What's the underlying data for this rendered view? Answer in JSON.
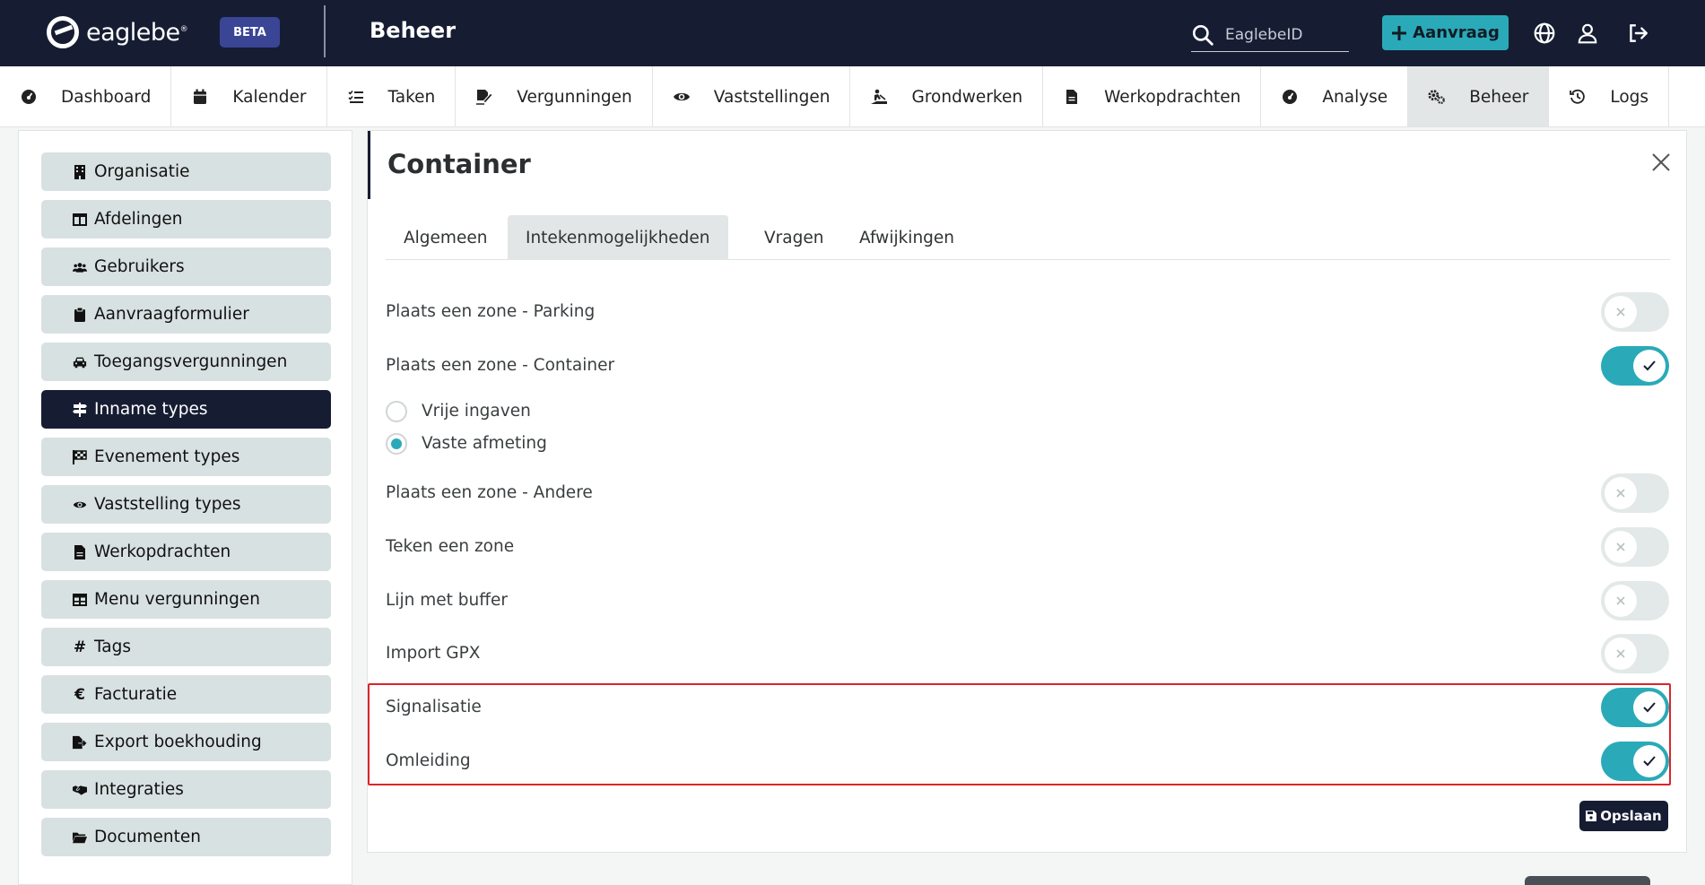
{
  "header": {
    "logo_text": "eaglebe",
    "logo_reg": "®",
    "beta_label": "BETA",
    "title": "Beheer",
    "search_placeholder": "EaglebeID",
    "aanvraag_label": "Aanvraag",
    "accent_color": "#2aaab8",
    "brand_color": "#161d33"
  },
  "nav": {
    "items": [
      {
        "label": "Dashboard",
        "icon": "gauge-icon"
      },
      {
        "label": "Kalender",
        "icon": "calendar-icon"
      },
      {
        "label": "Taken",
        "icon": "checklist-icon"
      },
      {
        "label": "Vergunningen",
        "icon": "signature-icon"
      },
      {
        "label": "Vaststellingen",
        "icon": "eye-icon"
      },
      {
        "label": "Grondwerken",
        "icon": "digging-icon"
      },
      {
        "label": "Werkopdrachten",
        "icon": "file-icon"
      },
      {
        "label": "Analyse",
        "icon": "gauge-icon"
      },
      {
        "label": "Beheer",
        "icon": "cogs-icon",
        "active": true
      },
      {
        "label": "Logs",
        "icon": "history-icon"
      }
    ]
  },
  "sidebar": {
    "items": [
      {
        "label": "Organisatie",
        "icon": "building-icon"
      },
      {
        "label": "Afdelingen",
        "icon": "columns-icon"
      },
      {
        "label": "Gebruikers",
        "icon": "users-icon"
      },
      {
        "label": "Aanvraagformulier",
        "icon": "clipboard-icon"
      },
      {
        "label": "Toegangsvergunningen",
        "icon": "car-icon"
      },
      {
        "label": "Inname types",
        "icon": "signs-icon",
        "active": true
      },
      {
        "label": "Evenement types",
        "icon": "flag-icon"
      },
      {
        "label": "Vaststelling types",
        "icon": "eye-icon"
      },
      {
        "label": "Werkopdrachten",
        "icon": "file-icon"
      },
      {
        "label": "Menu vergunningen",
        "icon": "table-icon"
      },
      {
        "label": "Tags",
        "icon": "hashtag-icon"
      },
      {
        "label": "Facturatie",
        "icon": "euro-icon"
      },
      {
        "label": "Export boekhouding",
        "icon": "file-export-icon"
      },
      {
        "label": "Integraties",
        "icon": "handshake-icon"
      },
      {
        "label": "Documenten",
        "icon": "folder-icon"
      }
    ]
  },
  "panel": {
    "title": "Container",
    "tabs": [
      {
        "label": "Algemeen"
      },
      {
        "label": "Intekenmogelijkheden",
        "active": true
      },
      {
        "label": "Vragen"
      },
      {
        "label": "Afwijkingen"
      }
    ],
    "options": [
      {
        "label": "Plaats een zone - Parking",
        "enabled": false
      },
      {
        "label": "Plaats een zone - Container",
        "enabled": true
      },
      {
        "label": "Plaats een zone - Andere",
        "enabled": false
      },
      {
        "label": "Teken een zone",
        "enabled": false
      },
      {
        "label": "Lijn met buffer",
        "enabled": false
      },
      {
        "label": "Import GPX",
        "enabled": false
      },
      {
        "label": "Signalisatie",
        "enabled": true
      },
      {
        "label": "Omleiding",
        "enabled": true
      }
    ],
    "radio_options": [
      {
        "label": "Vrije ingaven",
        "checked": false
      },
      {
        "label": "Vaste afmeting",
        "checked": true
      }
    ],
    "save_label": "Opslaan"
  }
}
